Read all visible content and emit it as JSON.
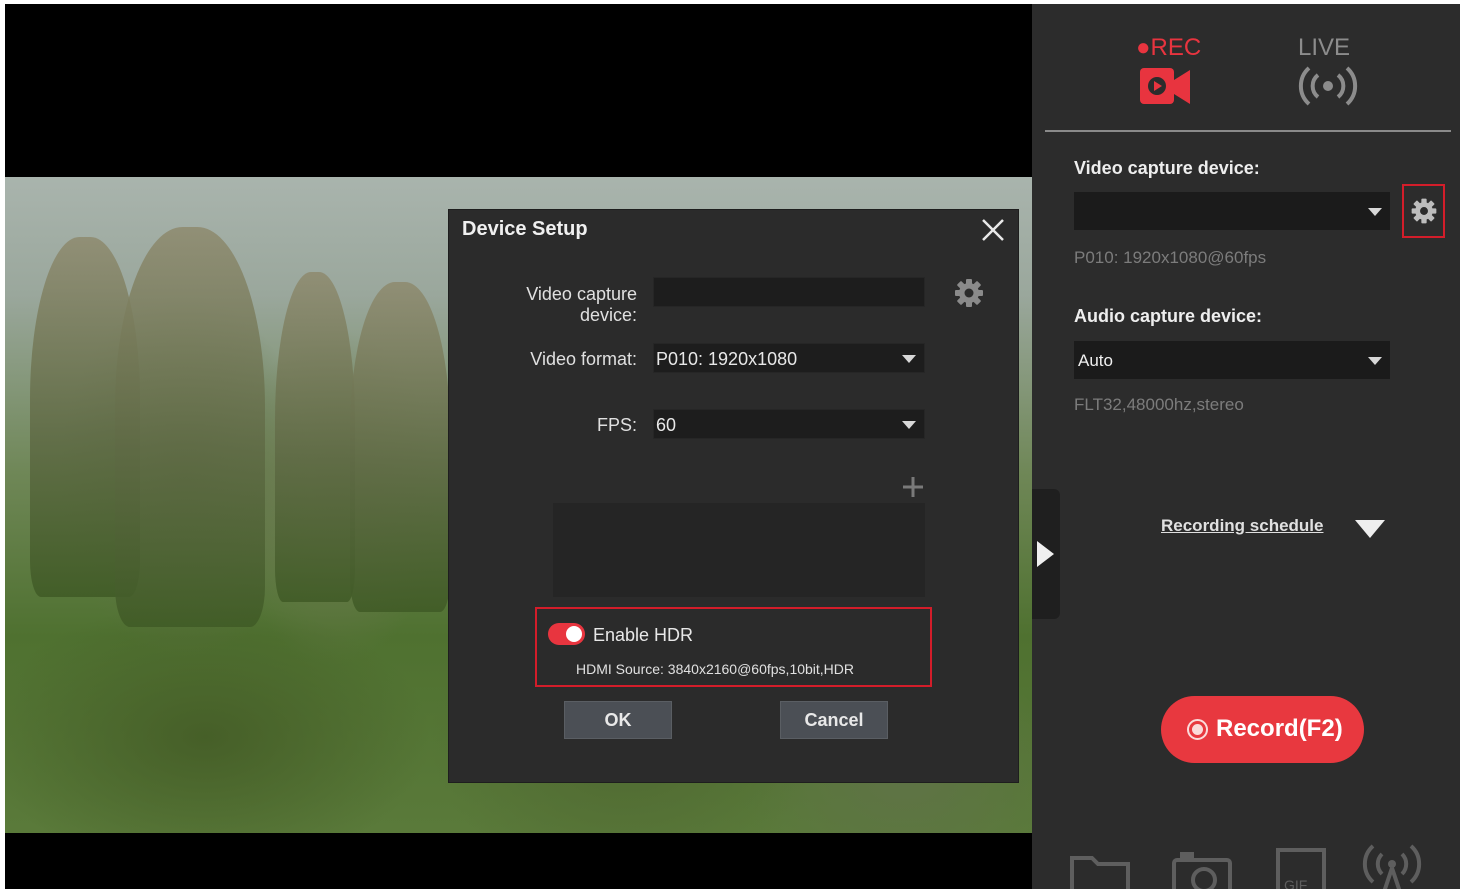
{
  "dialog": {
    "title": "Device Setup",
    "video_capture_label": "Video capture device:",
    "video_capture_value": "",
    "video_format_label": "Video format:",
    "video_format_value": "P010: 1920x1080",
    "fps_label": "FPS:",
    "fps_value": "60",
    "hdr_enabled": true,
    "hdr_label": "Enable HDR",
    "hdr_source": "HDMI Source: 3840x2160@60fps,10bit,HDR",
    "ok_label": "OK",
    "cancel_label": "Cancel"
  },
  "panel": {
    "tabs": [
      {
        "label": "●REC",
        "icon": "camera-icon",
        "active": true
      },
      {
        "label": "LIVE",
        "icon": "broadcast-icon",
        "active": false
      }
    ],
    "video_capture_heading": "Video capture device:",
    "video_capture_value": "",
    "video_info": "P010: 1920x1080@60fps",
    "audio_capture_heading": "Audio capture device:",
    "audio_capture_value": "Auto",
    "audio_info": "FLT32,48000hz,stereo",
    "schedule_label": "Recording schedule",
    "record_label": "Record(F2)",
    "bottom_icons": [
      "folder-icon",
      "camera-snapshot-icon",
      "gif-icon",
      "broadcast-tower-icon"
    ]
  },
  "colors": {
    "accent_red": "#e8383f",
    "highlight_red": "#d31d2a",
    "panel_bg": "#2c2c2c",
    "dialog_bg": "#2b2b2b"
  }
}
